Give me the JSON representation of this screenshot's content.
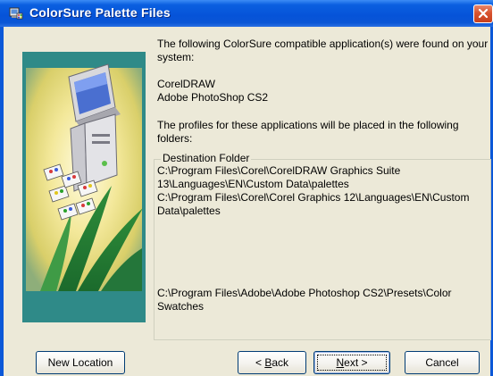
{
  "window": {
    "title": "ColorSure Palette Files"
  },
  "message": {
    "intro": "The following ColorSure compatible application(s) were found on your system:",
    "apps": [
      "CorelDRAW",
      "Adobe PhotoShop CS2"
    ],
    "profiles_note": "The profiles for these applications will be placed in the following folders:"
  },
  "destination": {
    "legend": "Destination Folder",
    "paths": [
      "C:\\Program Files\\Corel\\CorelDRAW Graphics Suite 13\\Languages\\EN\\Custom Data\\palettes",
      "C:\\Program Files\\Corel\\Corel Graphics 12\\Languages\\EN\\Custom Data\\palettes",
      "C:\\Program Files\\Adobe\\Adobe Photoshop CS2\\Presets\\Color Swatches"
    ]
  },
  "buttons": {
    "new_location": "New Location",
    "back_pre": "< ",
    "back_key": "B",
    "back_rest": "ack",
    "next_key": "N",
    "next_rest": "ext >",
    "cancel": "Cancel"
  },
  "icons": {
    "title": "palette-app-icon",
    "close": "close-icon",
    "art": "computer-palette-illustration"
  },
  "colors": {
    "titlebar": "#0653d8",
    "close": "#d8532f",
    "dialog_bg": "#ece9d8",
    "art_bg": "#2f8a88"
  }
}
